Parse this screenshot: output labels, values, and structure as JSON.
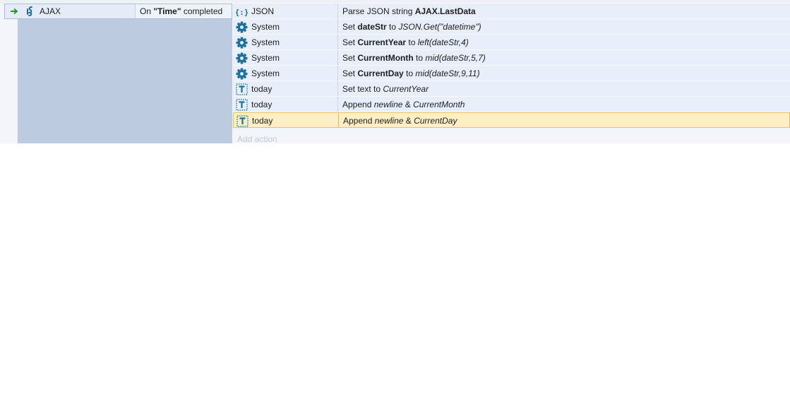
{
  "event": {
    "object": "AJAX",
    "condition_prefix": "On ",
    "condition_tag": "\"Time\"",
    "condition_suffix": " completed"
  },
  "actions": [
    {
      "icon": "json-icon",
      "object": "JSON",
      "parts": [
        [
          "Parse JSON string ",
          ""
        ],
        [
          "AJAX.LastData",
          "b"
        ]
      ]
    },
    {
      "icon": "gear-icon",
      "object": "System",
      "parts": [
        [
          "Set ",
          ""
        ],
        [
          "dateStr",
          "b"
        ],
        [
          " to ",
          ""
        ],
        [
          "JSON.Get(\"datetime\")",
          "i"
        ]
      ]
    },
    {
      "icon": "gear-icon",
      "object": "System",
      "parts": [
        [
          "Set ",
          ""
        ],
        [
          "CurrentYear",
          "b"
        ],
        [
          " to ",
          ""
        ],
        [
          "left(dateStr,4)",
          "i"
        ]
      ]
    },
    {
      "icon": "gear-icon",
      "object": "System",
      "parts": [
        [
          "Set ",
          ""
        ],
        [
          "CurrentMonth",
          "b"
        ],
        [
          " to ",
          ""
        ],
        [
          "mid(dateStr,5,7)",
          "i"
        ]
      ]
    },
    {
      "icon": "gear-icon",
      "object": "System",
      "parts": [
        [
          "Set ",
          ""
        ],
        [
          "CurrentDay",
          "b"
        ],
        [
          " to ",
          ""
        ],
        [
          "mid(dateStr,9,11)",
          "i"
        ]
      ]
    },
    {
      "icon": "text-icon",
      "object": "today",
      "parts": [
        [
          "Set text to ",
          ""
        ],
        [
          "CurrentYear",
          "i"
        ]
      ]
    },
    {
      "icon": "text-icon",
      "object": "today",
      "parts": [
        [
          "Append ",
          ""
        ],
        [
          "newline",
          "i"
        ],
        [
          " & ",
          ""
        ],
        [
          "CurrentMonth",
          "i"
        ]
      ]
    },
    {
      "icon": "text-icon",
      "object": "today",
      "selected": true,
      "parts": [
        [
          "Append ",
          ""
        ],
        [
          "newline",
          "i"
        ],
        [
          " & ",
          ""
        ],
        [
          "CurrentDay",
          "i"
        ]
      ]
    }
  ],
  "add_action_label": "Add action",
  "colors": {
    "selected_row": "#fcefc4",
    "action_row": "#e8eefa",
    "block_background": "#bccbdf",
    "icon_teal": "#1f6e9c",
    "arrow_green": "#2e9a2e"
  }
}
